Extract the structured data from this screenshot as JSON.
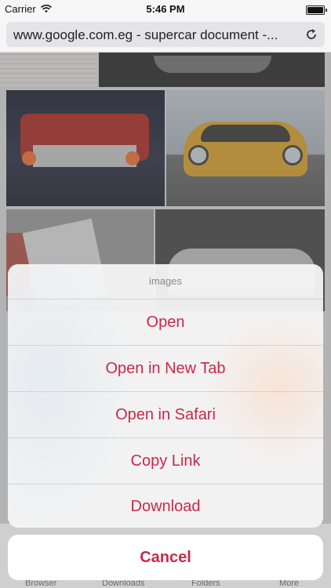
{
  "status": {
    "carrier": "Carrier",
    "time": "5:46 PM",
    "battery_level": 0.9
  },
  "url_bar": {
    "text": "www.google.com.eg - supercar document -...",
    "reload_icon": "reload-icon"
  },
  "toolbar": {
    "tabs": [
      "Browser",
      "Downloads",
      "Folders",
      "More"
    ]
  },
  "action_sheet": {
    "title": "images",
    "items": [
      "Open",
      "Open in New Tab",
      "Open in Safari",
      "Copy Link",
      "Download"
    ],
    "cancel": "Cancel",
    "accent_color": "#c8294a"
  }
}
